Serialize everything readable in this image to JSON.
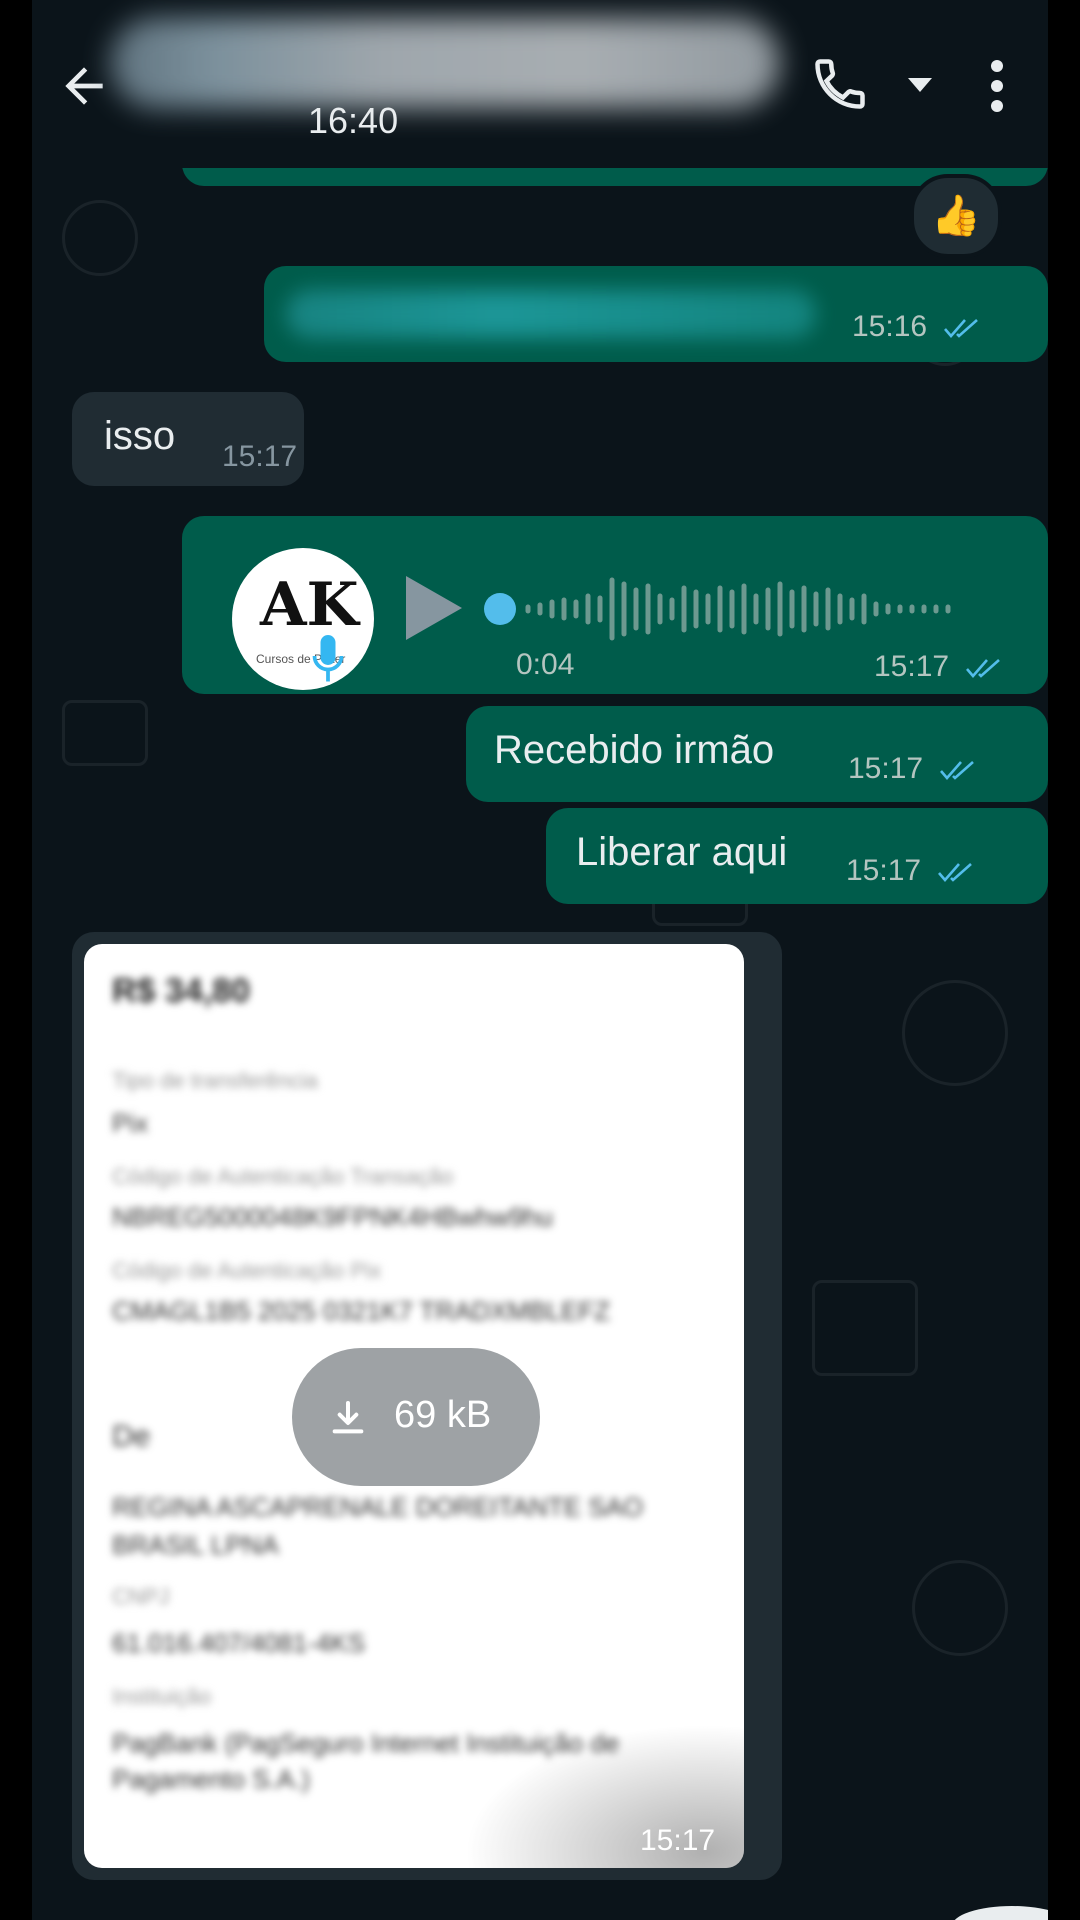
{
  "header": {
    "last_seen": "16:40"
  },
  "messages": {
    "reaction_emoji": "👍",
    "m1": {
      "time": "15:16"
    },
    "m2": {
      "text": "isso",
      "time": "15:17"
    },
    "voice": {
      "duration": "0:04",
      "time": "15:17",
      "avatar_logo": "AK",
      "avatar_sub": "Cursos de Poker"
    },
    "m4": {
      "text": "Recebido irmão",
      "time": "15:17"
    },
    "m5": {
      "text": "Liberar aqui",
      "time": "15:17"
    },
    "document": {
      "download_size": "69 kB",
      "time": "15:17",
      "blurred_lines": [
        "R$ 34,80",
        "Tipo de transferência",
        "Pix",
        "Código de Autenticação Transação",
        "NBREG5000048K9FPNK4HBwhw9hu",
        "Código de Autenticação Pix",
        "CMAGL1B5 2025 0321K7 TRADXMBLEFZ",
        "De",
        "REGINA ASCAPRENALE DOREITANTE SAO",
        "BRASIL LPNA",
        "CNPJ",
        "61.016.407/4081-4KS",
        "Instituição",
        "PagBank (PagSeguro Internet Instituição de",
        "Pagamento S.A.)"
      ]
    }
  },
  "colors": {
    "bg": "#0b141a",
    "outgoing": "#005c4b",
    "incoming": "#202c33",
    "read_ticks": "#53bdeb"
  },
  "icons": [
    "back-arrow-icon",
    "phone-icon",
    "chevron-down-icon",
    "more-vert-icon",
    "double-check-icon",
    "play-icon",
    "mic-icon",
    "download-icon"
  ]
}
